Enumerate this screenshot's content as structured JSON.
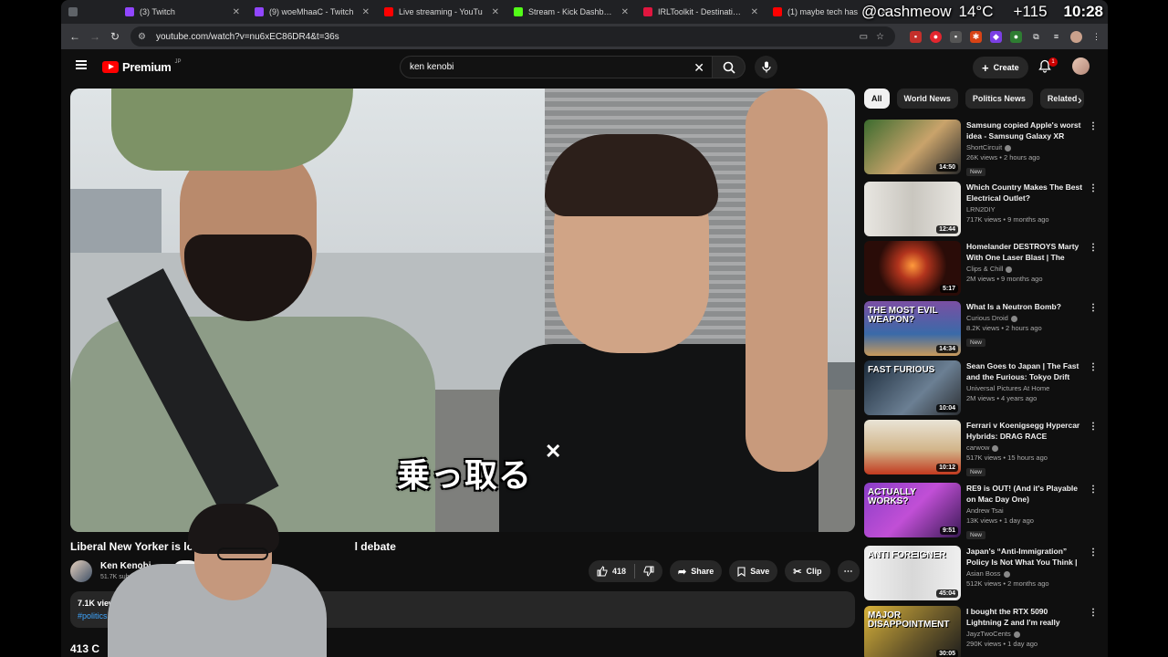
{
  "browser": {
    "tabs": [
      {
        "title": "",
        "fav": "#5f6368"
      },
      {
        "title": "(3) Twitch",
        "fav": "#9146ff"
      },
      {
        "title": "(9) woeMhaaC - Twitch",
        "fav": "#9146ff"
      },
      {
        "title": "Live streaming - YouTu",
        "fav": "#ff0000"
      },
      {
        "title": "Stream - Kick Dashboard",
        "fav": "#53fc18"
      },
      {
        "title": "IRLToolkit - Destinations",
        "fav": "#e0163f"
      },
      {
        "title": "(1) maybe tech has",
        "fav": "#ff0000"
      }
    ],
    "url": "youtube.com/watch?v=nu6xEC86DR4&t=36s"
  },
  "overlay": {
    "handle": "@cashmeow",
    "temperature": "14°C",
    "counter": "+115",
    "clock": "10:28"
  },
  "youtube": {
    "logo_text": "Premium",
    "logo_region": "JP",
    "search_value": "ken kenobi",
    "create_label": "Create",
    "notification_count": "1"
  },
  "video": {
    "caption": "乗っ取る",
    "title_left": "Liberal New Yorker is los",
    "title_right": "l debate",
    "channel": "Ken Kenobi",
    "subscribers": "51.7K subscri",
    "subscribe_label": "S",
    "likes": "418",
    "share_label": "Share",
    "save_label": "Save",
    "clip_label": "Clip",
    "views": "7.1K views",
    "views_suffix": "2",
    "hashtag": "#politics",
    "hashtag_suffix": "#",
    "comments": "413 C"
  },
  "chips": [
    "All",
    "World News",
    "Politics News",
    "Related"
  ],
  "recommended": [
    {
      "title": "Samsung copied Apple's worst idea - Samsung Galaxy XR",
      "channel": "ShortCircuit",
      "verified": true,
      "views": "26K views • 2 hours ago",
      "new": true,
      "duration": "14:50",
      "bg": "linear-gradient(135deg,#3b6b2e,#c9a36b 55%,#2b2b2b)",
      "thumb_text": ""
    },
    {
      "title": "Which Country Makes The Best Electrical Outlet?",
      "channel": "LRN2DIY",
      "verified": false,
      "views": "717K views • 9 months ago",
      "new": false,
      "duration": "12:44",
      "bg": "linear-gradient(90deg,#e8e6e1,#c9c6bf 50%,#e8e6e1)",
      "thumb_text": ""
    },
    {
      "title": "Homelander DESTROYS Marty With One Laser Blast | The Boy...",
      "channel": "Clips & Chill",
      "verified": true,
      "views": "2M views • 9 months ago",
      "new": false,
      "duration": "5:17",
      "bg": "radial-gradient(circle at 50% 45%,#ff9a3c 0,#b2341d 25%,#2a0c08 60%)",
      "thumb_text": ""
    },
    {
      "title": "What Is a Neutron Bomb?",
      "channel": "Curious Droid",
      "verified": true,
      "views": "8.2K views • 2 hours ago",
      "new": true,
      "duration": "14:34",
      "bg": "linear-gradient(180deg,#7b4fa3,#3a6aa8 60%,#c99a5b)",
      "thumb_text": "THE MOST EVIL WEAPON?"
    },
    {
      "title": "Sean Goes to Japan | The Fast and the Furious: Tokyo Drift",
      "channel": "Universal Pictures At Home",
      "verified": false,
      "views": "2M views • 4 years ago",
      "new": false,
      "duration": "10:04",
      "bg": "linear-gradient(135deg,#1b2a3a,#6b7f93 60%,#2c2f33)",
      "thumb_text": "FAST FURIOUS"
    },
    {
      "title": "Ferrari v Koenigsegg Hypercar Hybrids: DRAG RACE",
      "channel": "carwow",
      "verified": true,
      "views": "517K views • 15 hours ago",
      "new": true,
      "duration": "10:12",
      "bg": "linear-gradient(180deg,#e9e4d6,#d2b58a 55%,#c23a1f)",
      "thumb_text": ""
    },
    {
      "title": "RE9 is OUT! (And it's Playable on Mac Day One)",
      "channel": "Andrew Tsai",
      "verified": false,
      "views": "13K views • 1 day ago",
      "new": true,
      "duration": "9:51",
      "bg": "linear-gradient(135deg,#8a3ec7,#c14fd6 50%,#3a1a55)",
      "thumb_text": "ACTUALLY WORKS?"
    },
    {
      "title": "Japan's “Anti-Immigration” Policy Is Not What You Think | ...",
      "channel": "Asian Boss",
      "verified": true,
      "views": "512K views • 2 months ago",
      "new": false,
      "duration": "45:04",
      "bg": "linear-gradient(90deg,#efefef,#d8d8d8 50%,#efefef)",
      "thumb_text": "ANTI FOREIGNER"
    },
    {
      "title": "I bought the RTX 5090 Lightning Z and I'm really disappointed.....",
      "channel": "JayzTwoCents",
      "verified": true,
      "views": "290K views • 1 day ago",
      "new": false,
      "duration": "30:05",
      "bg": "linear-gradient(135deg,#d8b23a,#6b5a2a 55%,#1c1c1c)",
      "thumb_text": "MAJOR DISAPPOINTMENT"
    }
  ]
}
